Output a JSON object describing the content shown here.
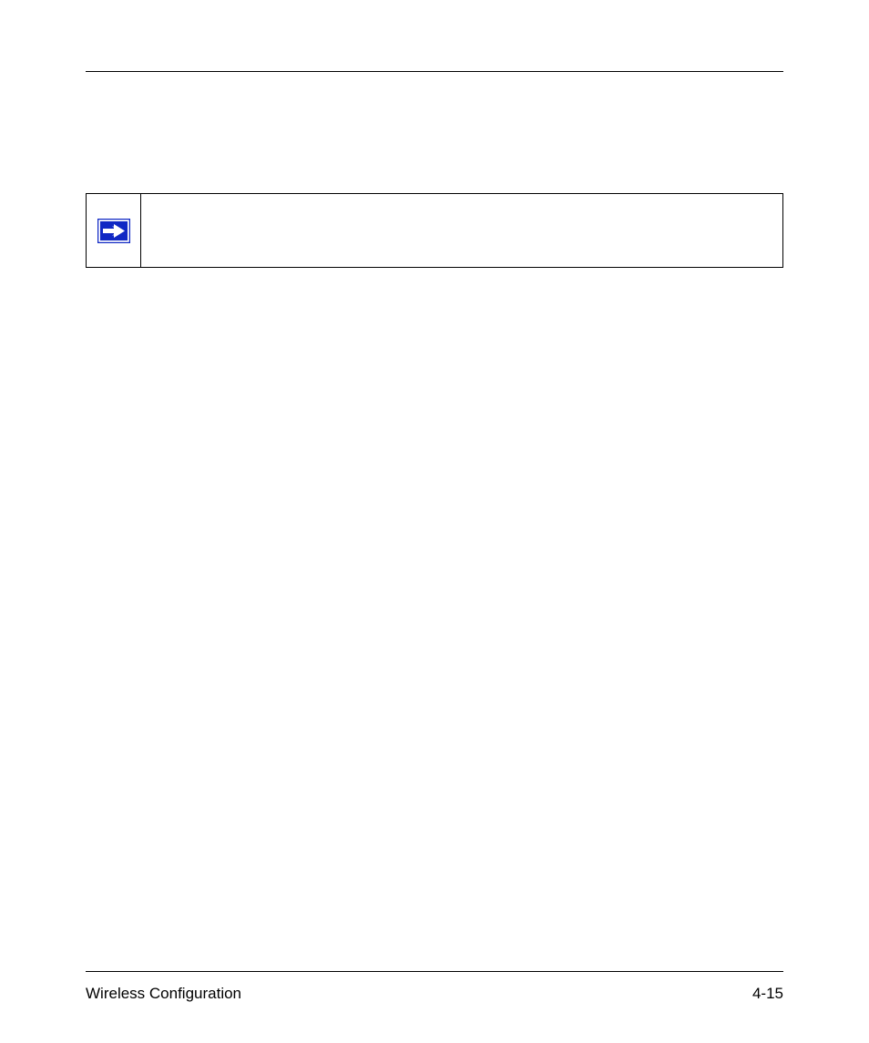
{
  "footer": {
    "section_title": "Wireless Configuration",
    "page_number": "4-15"
  },
  "note": {
    "icon_name": "arrow-right-icon",
    "content": ""
  }
}
